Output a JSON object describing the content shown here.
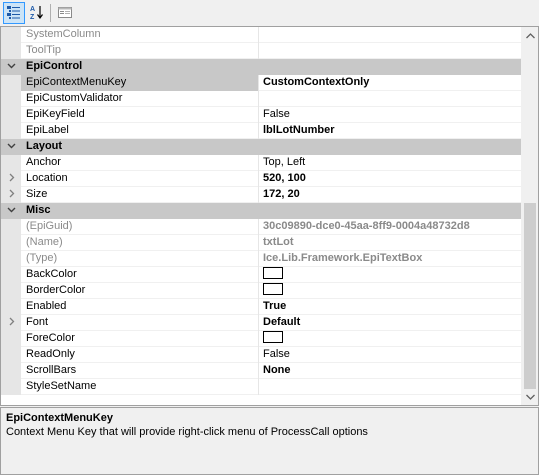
{
  "toolbar": {
    "categorized_icon": "categorized-view-icon",
    "alphabetical_icon": "alphabetical-sort-icon",
    "property_pages_icon": "property-pages-icon"
  },
  "properties": [
    {
      "type": "prop",
      "name": "SystemColumn",
      "value": "",
      "name_style": "readonly"
    },
    {
      "type": "prop",
      "name": "ToolTip",
      "value": "",
      "name_style": "readonly"
    },
    {
      "type": "category",
      "label": "EpiControl",
      "expander": "collapse"
    },
    {
      "type": "prop",
      "name": "EpiContextMenuKey",
      "value": "CustomContextOnly",
      "value_style": "bold",
      "selected": true
    },
    {
      "type": "prop",
      "name": "EpiCustomValidator",
      "value": ""
    },
    {
      "type": "prop",
      "name": "EpiKeyField",
      "value": "False"
    },
    {
      "type": "prop",
      "name": "EpiLabel",
      "value": "lblLotNumber",
      "value_style": "bold"
    },
    {
      "type": "category",
      "label": "Layout",
      "expander": "collapse"
    },
    {
      "type": "prop",
      "name": "Anchor",
      "value": "Top, Left"
    },
    {
      "type": "prop",
      "name": "Location",
      "value": "520, 100",
      "value_style": "bold",
      "expander": "expand"
    },
    {
      "type": "prop",
      "name": "Size",
      "value": "172, 20",
      "value_style": "bold",
      "expander": "expand"
    },
    {
      "type": "category",
      "label": "Misc",
      "expander": "collapse"
    },
    {
      "type": "prop",
      "name": "(EpiGuid)",
      "value": "30c09890-dce0-45aa-8ff9-0004a48732d8",
      "name_style": "readonly",
      "value_style": "readonly-bold"
    },
    {
      "type": "prop",
      "name": "(Name)",
      "value": "txtLot",
      "name_style": "readonly",
      "value_style": "readonly-bold"
    },
    {
      "type": "prop",
      "name": "(Type)",
      "value": "Ice.Lib.Framework.EpiTextBox",
      "name_style": "readonly",
      "value_style": "readonly-bold"
    },
    {
      "type": "prop",
      "name": "BackColor",
      "value": "",
      "swatch": "#ffffff"
    },
    {
      "type": "prop",
      "name": "BorderColor",
      "value": "",
      "swatch": "#ffffff"
    },
    {
      "type": "prop",
      "name": "Enabled",
      "value": "True",
      "value_style": "bold"
    },
    {
      "type": "prop",
      "name": "Font",
      "value": "Default",
      "value_style": "bold",
      "expander": "expand"
    },
    {
      "type": "prop",
      "name": "ForeColor",
      "value": "",
      "swatch": "#ffffff"
    },
    {
      "type": "prop",
      "name": "ReadOnly",
      "value": "False"
    },
    {
      "type": "prop",
      "name": "ScrollBars",
      "value": "None",
      "value_style": "bold"
    },
    {
      "type": "prop",
      "name": "StyleSetName",
      "value": ""
    }
  ],
  "description": {
    "title": "EpiContextMenuKey",
    "text": "Context Menu Key that will provide right-click menu of ProcessCall options"
  },
  "colors": {
    "category_bg": "#c8c8c8",
    "readonly_text": "#8a8a8a",
    "toolbar_active": "#cce4f7"
  }
}
